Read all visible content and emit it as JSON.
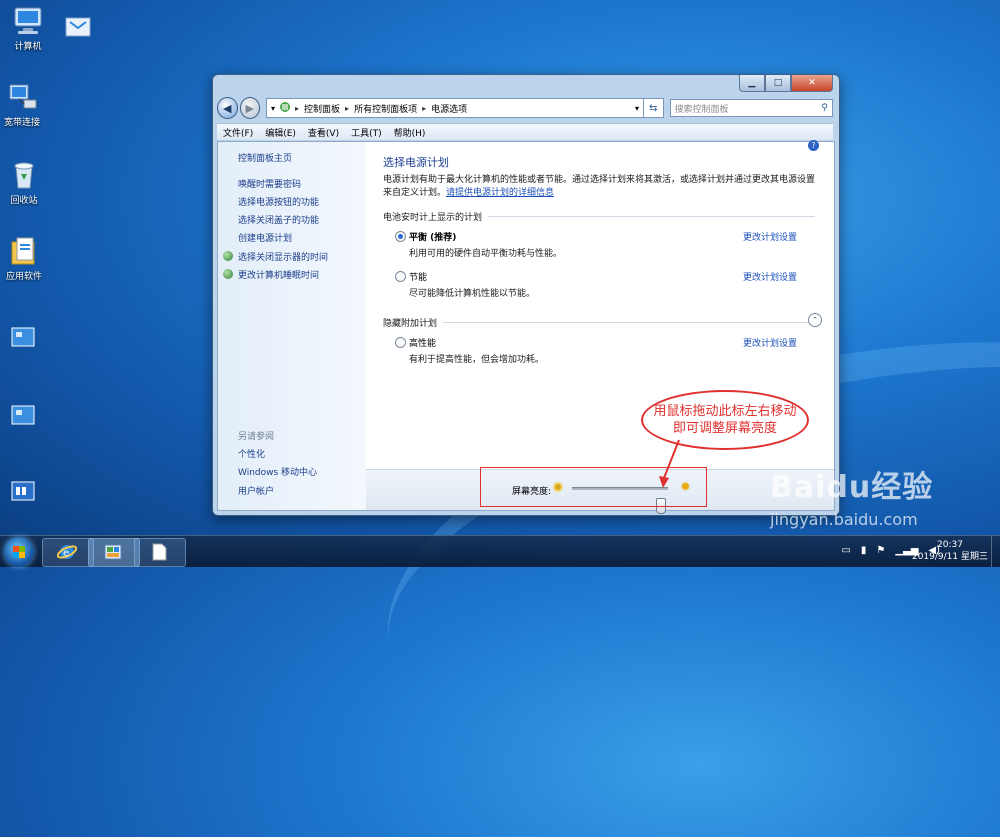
{
  "desktop": {
    "icons": [
      {
        "label": "计算机"
      },
      {
        "label": ""
      },
      {
        "label": "宽带连接"
      },
      {
        "label": "回收站"
      },
      {
        "label": "应用软件"
      }
    ]
  },
  "window": {
    "address": {
      "crumbs": [
        "控制面板",
        "所有控制面板项",
        "电源选项"
      ],
      "search_placeholder": "搜索控制面板"
    },
    "menu": [
      "文件(F)",
      "编辑(E)",
      "查看(V)",
      "工具(T)",
      "帮助(H)"
    ],
    "left_pane": {
      "home": "控制面板主页",
      "links": [
        "唤醒时需要密码",
        "选择电源按钮的功能",
        "选择关闭盖子的功能",
        "创建电源计划",
        "选择关闭显示器的时间",
        "更改计算机睡眠时间"
      ],
      "see_also_label": "另请参阅",
      "see_also": [
        "个性化",
        "Windows 移动中心",
        "用户帐户"
      ]
    },
    "main": {
      "title": "选择电源计划",
      "description": "电源计划有助于最大化计算机的性能或者节能。通过选择计划来将其激活，或选择计划并通过更改其电源设置来自定义计划。",
      "description_link": "请提供电源计划的详细信息",
      "battery_section": "电池安时计上显示的计划",
      "hidden_section": "隐藏附加计划",
      "plans": [
        {
          "name": "平衡 (推荐)",
          "desc": "利用可用的硬件自动平衡功耗与性能。",
          "link": "更改计划设置",
          "selected": true
        },
        {
          "name": "节能",
          "desc": "尽可能降低计算机性能以节能。",
          "link": "更改计划设置",
          "selected": false
        },
        {
          "name": "高性能",
          "desc": "有利于提高性能，但会增加功耗。",
          "link": "更改计划设置",
          "selected": false
        }
      ]
    },
    "brightness": {
      "label": "屏幕亮度:",
      "level": 0.92
    }
  },
  "annotation": {
    "callout_line1": "用鼠标拖动此标左右移动",
    "callout_line2": "即可调整屏幕亮度"
  },
  "taskbar": {
    "time": "20:37",
    "date": "2019/9/11 星期三"
  },
  "watermark": {
    "main": "Baidu经验",
    "url": "jingyan.baidu.com"
  }
}
